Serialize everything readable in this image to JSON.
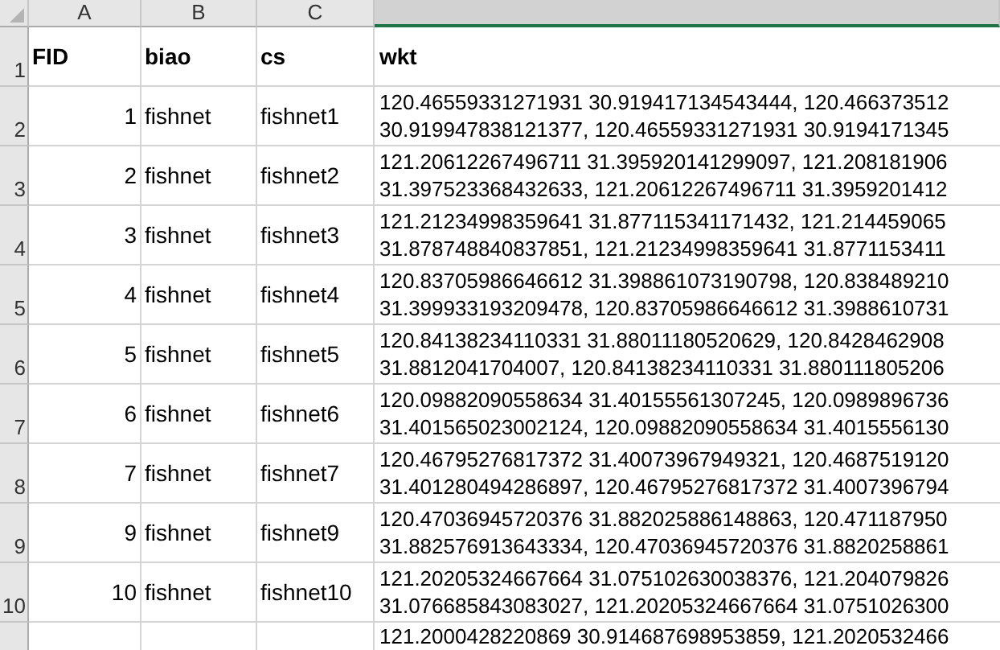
{
  "columns": [
    {
      "letter": "A",
      "selected": false
    },
    {
      "letter": "B",
      "selected": false
    },
    {
      "letter": "C",
      "selected": false
    },
    {
      "selected": true
    }
  ],
  "header_row": {
    "row_number": "1",
    "cells": [
      "FID",
      "biao",
      "cs",
      "wkt"
    ]
  },
  "rows": [
    {
      "row_number": "2",
      "fid": "1",
      "biao": "fishnet",
      "cs": "fishnet1",
      "wkt": [
        "120.46559331271931 30.919417134543444, 120.466373512",
        "30.919947838121377, 120.46559331271931 30.9194171345"
      ]
    },
    {
      "row_number": "3",
      "fid": "2",
      "biao": "fishnet",
      "cs": "fishnet2",
      "wkt": [
        "121.20612267496711 31.395920141299097, 121.208181906",
        "31.397523368432633, 121.20612267496711 31.3959201412"
      ]
    },
    {
      "row_number": "4",
      "fid": "3",
      "biao": "fishnet",
      "cs": "fishnet3",
      "wkt": [
        "121.21234998359641 31.877115341171432, 121.214459065",
        "31.878748840837851, 121.21234998359641 31.8771153411"
      ]
    },
    {
      "row_number": "5",
      "fid": "4",
      "biao": "fishnet",
      "cs": "fishnet4",
      "wkt": [
        "120.83705986646612 31.398861073190798, 120.838489210",
        "31.399933193209478, 120.83705986646612 31.3988610731"
      ]
    },
    {
      "row_number": "6",
      "fid": "5",
      "biao": "fishnet",
      "cs": "fishnet5",
      "wkt": [
        "120.84138234110331 31.88011180520629, 120.8428462908",
        "31.8812041704007, 120.84138234110331 31.880111805206"
      ]
    },
    {
      "row_number": "7",
      "fid": "6",
      "biao": "fishnet",
      "cs": "fishnet6",
      "wkt": [
        "120.09882090558634 31.40155561307245, 120.0989896736",
        "31.401565023002124, 120.09882090558634 31.4015556130"
      ]
    },
    {
      "row_number": "8",
      "fid": "7",
      "biao": "fishnet",
      "cs": "fishnet7",
      "wkt": [
        "120.46795276817372 31.40073967949321, 120.4687519120",
        "31.401280494286897, 120.46795276817372 31.4007396794"
      ]
    },
    {
      "row_number": "9",
      "fid": "9",
      "biao": "fishnet",
      "cs": "fishnet9",
      "wkt": [
        "120.47036945720376 31.882025886148863, 120.471187950",
        "31.882576913643334, 120.47036945720376 31.8820258861"
      ]
    },
    {
      "row_number": "10",
      "fid": "10",
      "biao": "fishnet",
      "cs": "fishnet10",
      "wkt": [
        "121.20205324667664 31.075102630038376, 121.204079826",
        "31.076685843083027, 121.20205324667664 31.0751026300"
      ]
    },
    {
      "wkt": [
        "121.2000428220869 30.914687698953859, 121.2020532466"
      ]
    }
  ]
}
